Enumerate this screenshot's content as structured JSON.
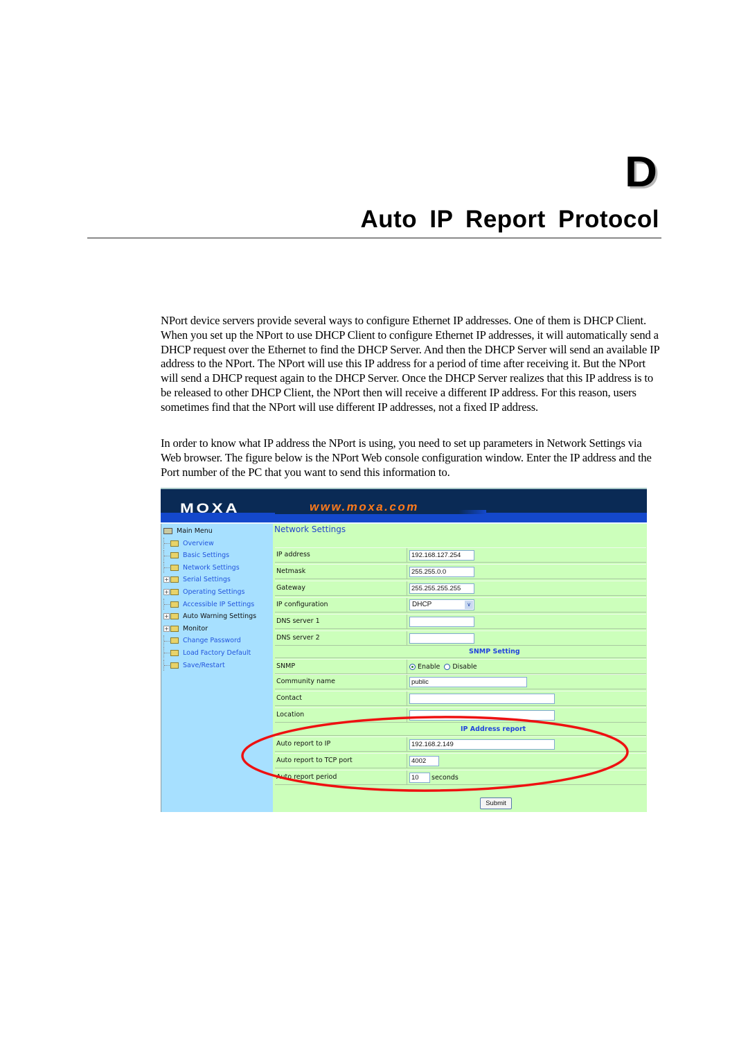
{
  "chapter": {
    "letter": "D",
    "title": "Auto IP Report Protocol"
  },
  "paragraphs": [
    "NPort device servers provide several ways to configure Ethernet IP addresses. One of them is DHCP Client. When you set up the NPort to use DHCP Client to configure Ethernet IP addresses, it will automatically send a DHCP request over the Ethernet to find the DHCP Server. And then the DHCP Server will send an available IP address to the NPort. The NPort will use this IP address for a period of time after receiving it. But the NPort will send a DHCP request again to the DHCP Server. Once the DHCP Server realizes that this IP address is to be released to other DHCP Client, the NPort then will receive a different IP address. For this reason, users sometimes find that the NPort will use different IP addresses, not a fixed IP address.",
    "In order to know what IP address the NPort is using, you need to set up parameters in Network Settings via Web browser. The figure below is the NPort Web console configuration window. Enter the IP address and the Port number of the PC that you want to send this information to."
  ],
  "console": {
    "logo": "MOXA",
    "url": "www.moxa.com",
    "colors": {
      "header": "#0a2a55",
      "band": "#1448cc",
      "url": "#ff7a1a",
      "sidebar": "#a7e0ff",
      "content": "#ccffbb",
      "link": "#2255dd",
      "highlight": "#ee1111"
    },
    "menu": {
      "root": "Main Menu",
      "items": [
        {
          "label": "Overview",
          "expandable": false,
          "style": "link"
        },
        {
          "label": "Basic Settings",
          "expandable": false,
          "style": "link"
        },
        {
          "label": "Network Settings",
          "expandable": false,
          "style": "link"
        },
        {
          "label": "Serial Settings",
          "expandable": true,
          "style": "link"
        },
        {
          "label": "Operating Settings",
          "expandable": true,
          "style": "link"
        },
        {
          "label": "Accessible IP Settings",
          "expandable": false,
          "style": "link"
        },
        {
          "label": "Auto Warning Settings",
          "expandable": true,
          "style": "dark"
        },
        {
          "label": "Monitor",
          "expandable": true,
          "style": "dark"
        },
        {
          "label": "Change Password",
          "expandable": false,
          "style": "link"
        },
        {
          "label": "Load Factory Default",
          "expandable": false,
          "style": "link"
        },
        {
          "label": "Save/Restart",
          "expandable": false,
          "style": "link"
        }
      ]
    },
    "page_title": "Network Settings",
    "network": {
      "ip_address": {
        "label": "IP address",
        "value": "192.168.127.254"
      },
      "netmask": {
        "label": "Netmask",
        "value": "255.255.0.0"
      },
      "gateway": {
        "label": "Gateway",
        "value": "255.255.255.255"
      },
      "ip_config": {
        "label": "IP configuration",
        "value": "DHCP"
      },
      "dns1": {
        "label": "DNS server 1",
        "value": ""
      },
      "dns2": {
        "label": "DNS server 2",
        "value": ""
      }
    },
    "snmp_section": "SNMP Setting",
    "snmp": {
      "snmp": {
        "label": "SNMP",
        "enable": "Enable",
        "disable": "Disable",
        "selected": "Enable"
      },
      "community": {
        "label": "Community name",
        "value": "public"
      },
      "contact": {
        "label": "Contact",
        "value": ""
      },
      "location": {
        "label": "Location",
        "value": ""
      }
    },
    "ip_report_section": "IP Address report",
    "ip_report": {
      "report_ip": {
        "label": "Auto report to IP",
        "value": "192.168.2.149"
      },
      "report_port": {
        "label": "Auto report to TCP port",
        "value": "4002"
      },
      "report_period": {
        "label": "Auto report period",
        "value": "10",
        "unit": "seconds"
      }
    },
    "submit_label": "Submit"
  }
}
